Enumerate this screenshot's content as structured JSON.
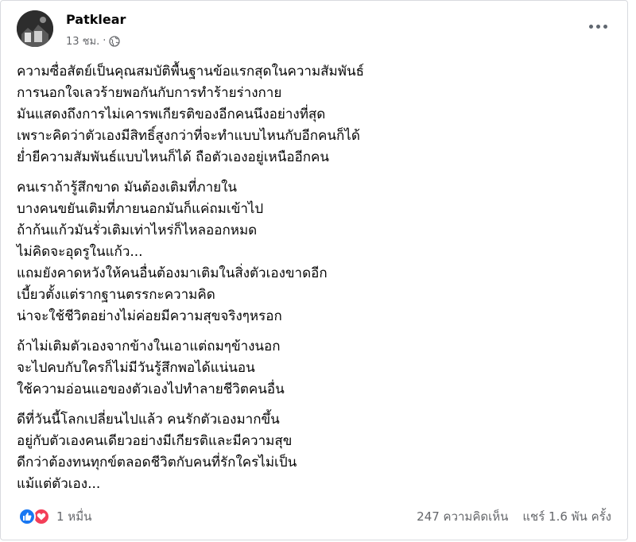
{
  "post": {
    "author": "Patklear",
    "time": "13 ชม.",
    "separator": "·",
    "privacy_icon": "globe-icon",
    "paragraphs": [
      {
        "lines": [
          "ความซื่อสัตย์เป็นคุณสมบัติพื้นฐานข้อแรกสุดในความสัมพันธ์",
          "การนอกใจเลวร้ายพอกันกับการทำร้ายร่างกาย",
          "มันแสดงถึงการไม่เคารพเกียรติของอีกคนนึงอย่างที่สุด",
          "เพราะคิดว่าตัวเองมีสิทธิ์สูงกว่าที่จะทำแบบไหนกับอีกคนก็ได้",
          "ย่ำยีความสัมพันธ์แบบไหนก็ได้ ถือตัวเองอยู่เหนืออีกคน"
        ]
      },
      {
        "lines": [
          "คนเราถ้ารู้สึกขาด มันต้องเติมที่ภายใน",
          "บางคนขยันเติมที่ภายนอกมันก็แค่ถมเข้าไป",
          "ถ้าก้นแก้วมันรั่วเติมเท่าไหร่ก็ไหลออกหมด",
          "ไม่คิดจะอุดรูในแก้ว...",
          "แถมยังคาดหวังให้คนอื่นต้องมาเติมในสิ่งตัวเองขาดอีก",
          "เบี้ยวตั้งแต่รากฐานตรรกะความคิด",
          "น่าจะใช้ชีวิตอย่างไม่ค่อยมีความสุขจริงๆหรอก"
        ]
      },
      {
        "lines": [
          "ถ้าไม่เติมตัวเองจากข้างในเอาแต่ถมๆข้างนอก",
          "จะไปคบกับใครก็ไม่มีวันรู้สึกพอได้แน่นอน",
          "ใช้ความอ่อนแอของตัวเองไปทำลายชีวิตคนอื่น"
        ]
      },
      {
        "lines": [
          "ดีที่วันนี้โลกเปลี่ยนไปแล้ว คนรักตัวเองมากขึ้น",
          "อยู่กับตัวเองคนเดียวอย่างมีเกียรติและมีความสุข",
          "ดีกว่าต้องทนทุกข์ตลอดชีวิตกับคนที่รักใครไม่เป็น",
          "แม้แต่ตัวเอง..."
        ]
      }
    ],
    "reactions": {
      "icons": [
        "like-icon",
        "love-icon"
      ],
      "count": "1 หมื่น"
    },
    "comments": "247 ความคิดเห็น",
    "shares": "แชร์ 1.6 พัน ครั้ง",
    "colors": {
      "like": "#1877f2",
      "love": "#f33e58",
      "secondary_text": "#65676b"
    }
  }
}
